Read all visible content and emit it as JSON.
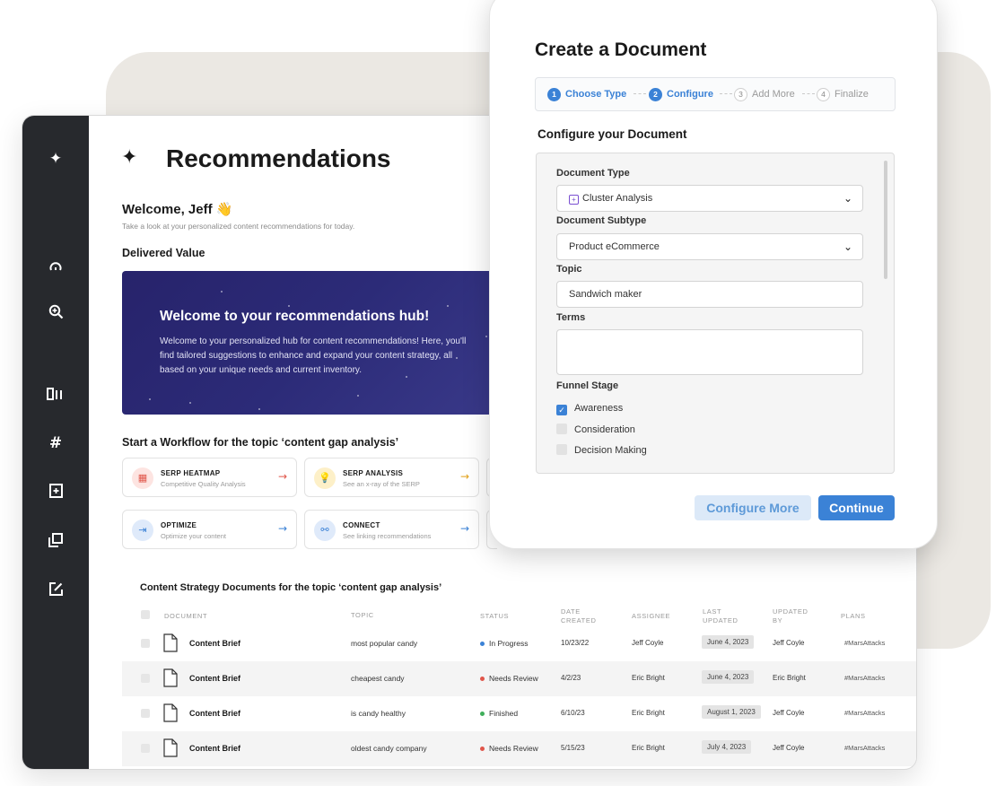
{
  "main": {
    "title": "Recommendations",
    "welcome": "Welcome, Jeff 👋",
    "welcome_sub": "Take a look at your personalized content recommendations for today.",
    "delivered_value": "Delivered Value",
    "hero": {
      "title": "Welcome to your recommendations hub!",
      "body": "Welcome to your personalized hub for content recommendations! Here, you'll find tailored suggestions to enhance and expand your content strategy, all based on your unique needs and current inventory."
    },
    "workflow_title": "Start a Workflow for the topic ‘content gap analysis’",
    "workflows": [
      {
        "name": "SERP HEATMAP",
        "sub": "Competitive Quality Analysis",
        "icon": "heatmap-icon",
        "color": "#e0564a",
        "bg": "#fde4e1"
      },
      {
        "name": "SERP ANALYSIS",
        "sub": "See an x-ray of the SERP",
        "icon": "lightbulb-icon",
        "color": "#e3a21a",
        "bg": "#fdf0c8"
      },
      {
        "name": "OPTIMIZE",
        "sub": "Optimize your content",
        "icon": "optimize-icon",
        "color": "#3b82d6",
        "bg": "#dfeafa"
      },
      {
        "name": "CONNECT",
        "sub": "See linking recommendations",
        "icon": "connect-icon",
        "color": "#3b82d6",
        "bg": "#dfeafa"
      }
    ],
    "docs_title": "Content Strategy Documents for the topic ‘content gap analysis’",
    "table": {
      "headers": {
        "document": "DOCUMENT",
        "topic": "TOPIC",
        "status": "STATUS",
        "date_created": "DATE\nCREATED",
        "assignee": "ASSIGNEE",
        "last_updated": "LAST\nUPDATED",
        "updated_by": "UPDATED\nBY",
        "plans": "PLANS"
      },
      "rows": [
        {
          "document": "Content Brief",
          "topic": "most popular candy",
          "status": "In Progress",
          "status_color": "#3b82d6",
          "date_created": "10/23/22",
          "assignee": "Jeff Coyle",
          "last_updated": "June 4, 2023",
          "updated_by": "Jeff Coyle",
          "plans": "#MarsAttacks"
        },
        {
          "document": "Content Brief",
          "topic": "cheapest candy",
          "status": "Needs Review",
          "status_color": "#e0564a",
          "date_created": "4/2/23",
          "assignee": "Eric Bright",
          "last_updated": "June 4, 2023",
          "updated_by": "Eric Bright",
          "plans": "#MarsAttacks"
        },
        {
          "document": "Content Brief",
          "topic": "is candy healthy",
          "status": "Finished",
          "status_color": "#3fae5a",
          "date_created": "6/10/23",
          "assignee": "Eric Bright",
          "last_updated": "August 1, 2023",
          "updated_by": "Jeff Coyle",
          "plans": "#MarsAttacks"
        },
        {
          "document": "Content Brief",
          "topic": "oldest candy company",
          "status": "Needs Review",
          "status_color": "#e0564a",
          "date_created": "5/15/23",
          "assignee": "Eric Bright",
          "last_updated": "July 4, 2023",
          "updated_by": "Jeff Coyle",
          "plans": "#MarsAttacks"
        }
      ]
    }
  },
  "rail": {
    "icons": [
      "sparkle-icon",
      "gauge-icon",
      "search-zoom-icon",
      "columns-icon",
      "hashtag-icon",
      "document-add-icon",
      "copy-icon",
      "edit-icon"
    ]
  },
  "modal": {
    "title": "Create a Document",
    "steps": [
      {
        "num": "1",
        "label": "Choose Type",
        "state": "active"
      },
      {
        "num": "2",
        "label": "Configure",
        "state": "active"
      },
      {
        "num": "3",
        "label": "Add More",
        "state": "todo"
      },
      {
        "num": "4",
        "label": "Finalize",
        "state": "todo"
      }
    ],
    "section_title": "Configure your Document",
    "document_type_label": "Document Type",
    "document_type_value": "Cluster Analysis",
    "document_subtype_label": "Document Subtype",
    "document_subtype_value": "Product eCommerce",
    "topic_label": "Topic",
    "topic_value": "Sandwich maker",
    "terms_label": "Terms",
    "terms_value": "",
    "funnel_label": "Funnel Stage",
    "funnel_options": [
      {
        "label": "Awareness",
        "checked": true
      },
      {
        "label": "Consideration",
        "checked": false
      },
      {
        "label": "Decision Making",
        "checked": false
      }
    ],
    "configure_more_label": "Configure More",
    "continue_label": "Continue"
  },
  "colors": {
    "accent": "#3b82d6",
    "rail": "#27292d",
    "hero": "#2c2b78"
  }
}
